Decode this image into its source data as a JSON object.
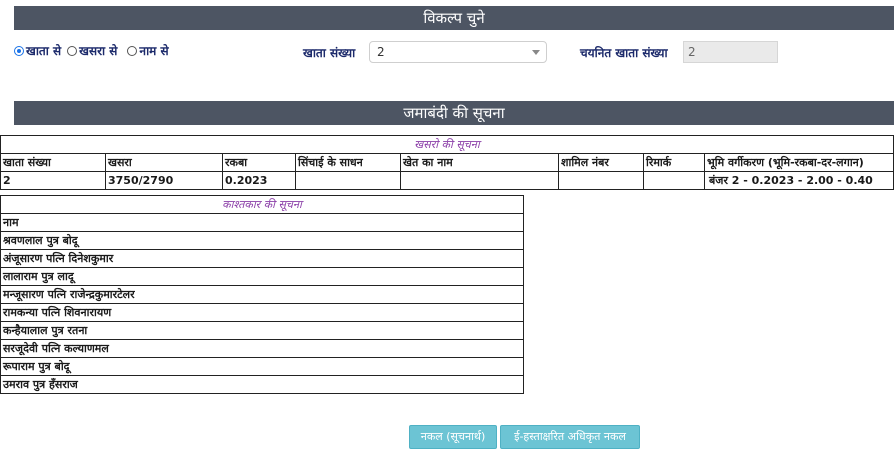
{
  "options_bar": {
    "title": "विकल्प चुने"
  },
  "search_options": [
    {
      "label": "खाता से",
      "selected": true
    },
    {
      "label": "खसरा से",
      "selected": false
    },
    {
      "label": "नाम से",
      "selected": false
    }
  ],
  "khata_select": {
    "label": "खाता संख्या",
    "value": "2"
  },
  "selected_khata": {
    "label": "चयनित खाता संख्या",
    "value": "2"
  },
  "jamabandi_bar": {
    "title": "जमाबंदी की सूचना"
  },
  "khasra_table": {
    "caption": "खसरो की सूचना",
    "headers": [
      "खाता संख्या",
      "खसरा",
      "रकबा",
      "सिंचाई के साधन",
      "खेत का नाम",
      "शामिल नंबर",
      "रिमार्क",
      "भूमि वर्गीकरण (भूमि-रकबा-दर-लगान)"
    ],
    "rows": [
      [
        "2",
        "3750/2790",
        "0.2023",
        "",
        "",
        "",
        "",
        "बंजर 2 - 0.2023 - 2.00 - 0.40"
      ]
    ]
  },
  "farmer_table": {
    "caption": "काश्तकार की सूचना",
    "header": "नाम",
    "names": [
      "श्रवणलाल पुत्र बोदू",
      "अंजूसारण पत्नि दिनेशकुमार",
      "लालाराम पुत्र लादू",
      "मन्जूसारण पत्नि राजेन्द्रकुमारटेलर",
      "रामकन्या पत्नि शिवनारायण",
      "कन्हैयालाल पुत्र रतना",
      "सरजूदेवी पत्नि कल्याणमल",
      "रूपाराम पुत्र बोदू",
      "उमराव पुत्र हँसराज"
    ]
  },
  "buttons": {
    "copy": "नकल (सूचनार्थ)",
    "esigned_copy": "ई-हस्ताक्षरित अधिकृत नकल"
  }
}
